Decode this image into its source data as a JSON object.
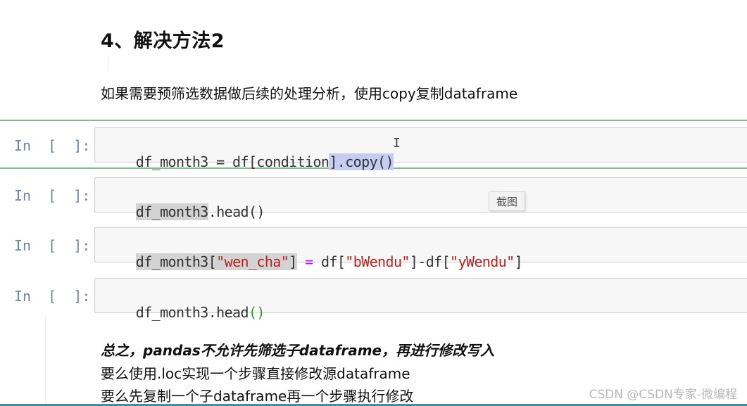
{
  "markdown": {
    "heading": "4、解决方法2",
    "paragraph": "如果需要预筛选数据做后续的处理分析，使用copy复制dataframe"
  },
  "cells": [
    {
      "prompt": "In  [  ]:",
      "code": {
        "a": "df_month3 = df[condition",
        "b": "].copy()"
      }
    },
    {
      "prompt": "In  [  ]:",
      "code": {
        "a": "df_month3",
        "b": ".head()"
      }
    },
    {
      "prompt": "In  [  ]:",
      "code": {
        "var": "df_month3",
        "br1": "[",
        "s1": "\"wen_cha\"",
        "br2": "]",
        "eq": " = ",
        "df1": "df[",
        "s2": "\"bWendu\"",
        "minus": "]-df[",
        "s3": "\"yWendu\"",
        "end": "]"
      }
    },
    {
      "prompt": "In  [  ]:",
      "code": {
        "a": "df_month3.head",
        "b": "()"
      }
    }
  ],
  "tooltip": "截图",
  "summary": {
    "line1": "总之，pandas不允许先筛选子dataframe，再进行修改写入",
    "line2": "要么使用.loc实现一个步骤直接修改源dataframe",
    "line3": "要么先复制一个子dataframe再一个步骤执行修改"
  },
  "watermark": "CSDN @CSDN专家-微编程",
  "colors": {
    "selected_border": "#7fbf7f",
    "prompt": "#6e84a3",
    "string": "#ba2121",
    "selection": "#c6cdf2"
  }
}
